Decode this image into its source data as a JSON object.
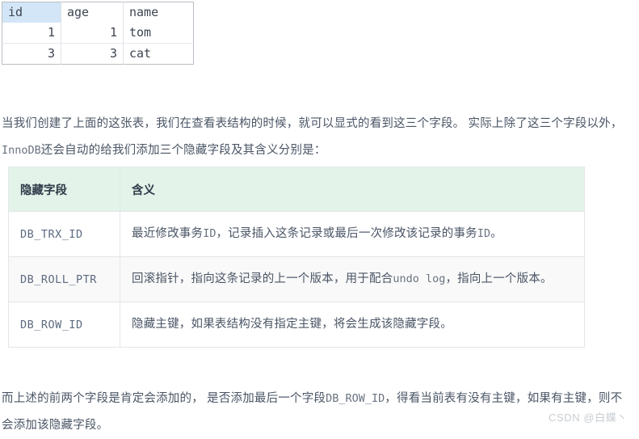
{
  "resultset": {
    "columns": [
      {
        "label": "id",
        "selected": true,
        "align": "num"
      },
      {
        "label": "age",
        "selected": false,
        "align": "num"
      },
      {
        "label": "name",
        "selected": false,
        "align": "txt"
      }
    ],
    "rows": [
      {
        "id": "1",
        "age": "1",
        "name": "tom"
      },
      {
        "id": "3",
        "age": "3",
        "name": "cat"
      }
    ]
  },
  "paragraphs": {
    "intro_a": "当我们创建了上面的这张表，我们在查看表结构的时候，就可以显式的看到这三个字段。  实际上除了这三个字段以外，",
    "intro_code": "InnoDB",
    "intro_b": "还会自动的给我们添加三个隐藏字段及其含义分别是：",
    "outro_a": "而上述的前两个字段是肯定会添加的， 是否添加最后一个字段",
    "outro_code": "DB_ROW_ID",
    "outro_b": "，得看当前表有没有主键，如果有主键，则不会添加该隐藏字段。"
  },
  "hidden_fields_table": {
    "headers": [
      "隐藏字段",
      "含义"
    ],
    "rows": [
      {
        "field": "DB_TRX_ID",
        "meaning_a": "最近修改事务",
        "meaning_code1": "ID",
        "meaning_b": "，记录插入这条记录或最后一次修改该记录的事务",
        "meaning_code2": "ID",
        "meaning_c": "。"
      },
      {
        "field": "DB_ROLL_PTR",
        "meaning_a": "回滚指针，指向这条记录的上一个版本，用于配合",
        "meaning_code1": "undo log",
        "meaning_b": "，指向上一个版本。",
        "meaning_code2": "",
        "meaning_c": ""
      },
      {
        "field": "DB_ROW_ID",
        "meaning_a": "隐藏主键，如果表结构没有指定主键，将会生成该隐藏字段。",
        "meaning_code1": "",
        "meaning_b": "",
        "meaning_code2": "",
        "meaning_c": ""
      }
    ]
  },
  "watermark": {
    "text": "CSDN @白蝶丶"
  },
  "colors": {
    "header_green": "#e3f3e9",
    "selected_column_blue": "#d3e6f7",
    "alt_row_gray": "#f9f9f9",
    "body_text": "#4a5565",
    "code_text": "#6a7380",
    "watermark": "#c8ccd2"
  }
}
